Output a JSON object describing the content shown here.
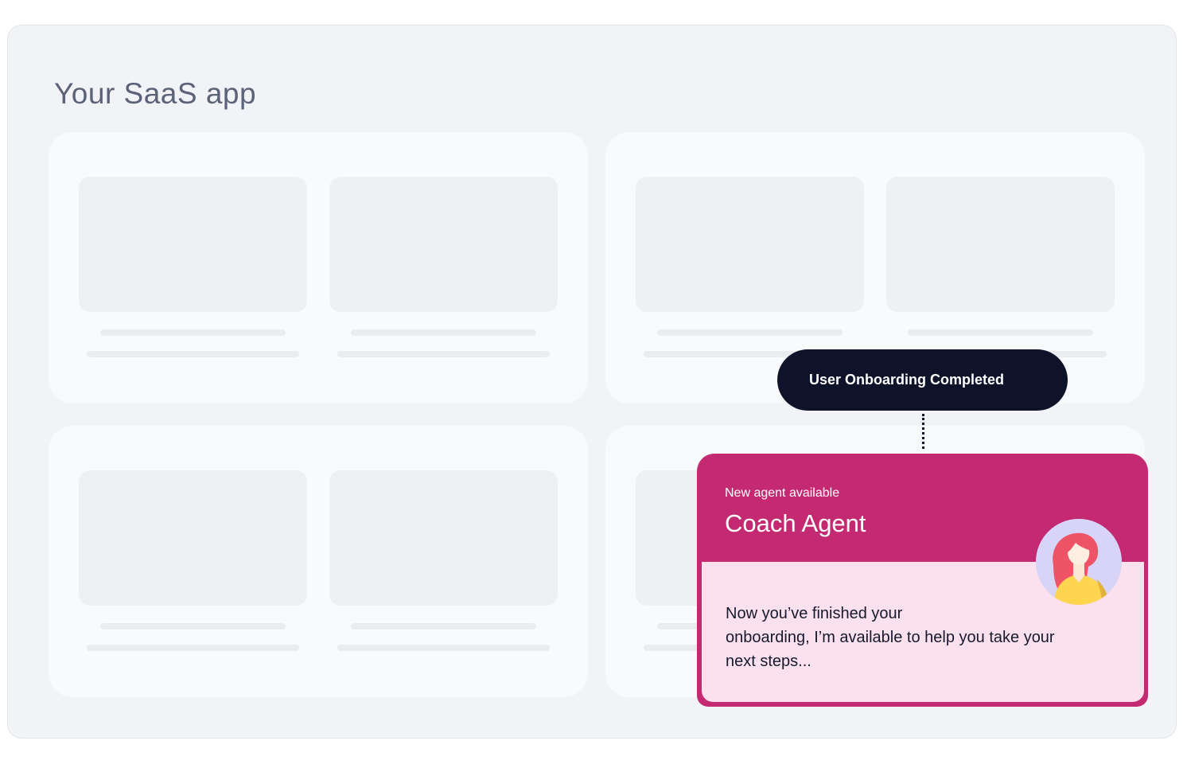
{
  "app": {
    "title": "Your SaaS app"
  },
  "event": {
    "label": "User Onboarding Completed"
  },
  "agent_notification": {
    "subtitle": "New agent available",
    "name": "Coach Agent",
    "message_line1": "Now you’ve finished your",
    "message_line2": "onboarding, I’m available to help you take your",
    "message_line3": "next steps...",
    "avatar_icon": "woman-avatar-icon"
  },
  "colors": {
    "frame_background": "#f2f3f7",
    "card_background": "#f9fafb",
    "placeholder": "#eff0f4",
    "pill_background": "#0f1329",
    "agent_accent": "#c42a72",
    "agent_body": "#fbe0ee",
    "title_text": "#5c6278"
  }
}
